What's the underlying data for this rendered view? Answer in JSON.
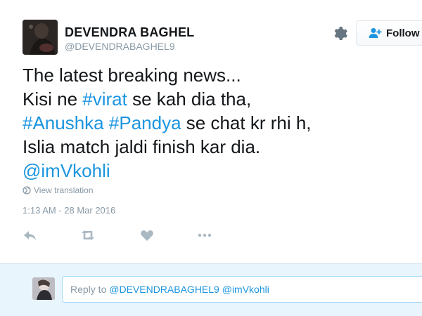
{
  "header": {
    "display_name": "DEVENDRA BAGHEL",
    "screen_name": "@DEVENDRABAGHEL9",
    "gear_icon": "gear-icon",
    "follow_label": "Follow",
    "follow_icon": "add-person-icon"
  },
  "tweet": {
    "line1": "The latest breaking news...",
    "line2_pre": "Kisi ne ",
    "line2_tag": "#virat",
    "line2_post": " se kah dia tha,",
    "line3_tag1": "#Anushka",
    "line3_space": " ",
    "line3_tag2": "#Pandya",
    "line3_post": " se chat kr rhi h,",
    "line4": "Islia match jaldi finish kar dia.",
    "line5_mention": "@imVkohli",
    "view_translation": "View translation",
    "timestamp": "1:13 AM - 28 Mar 2016"
  },
  "actions": [
    "reply-icon",
    "retweet-icon",
    "like-icon",
    "more-icon"
  ],
  "reply": {
    "prefix": "Reply to ",
    "mentions": "@DEVENDRABAGHEL9 @imVkohli"
  },
  "colors": {
    "link": "#1b95e0",
    "muted": "#8899a6",
    "reply_bg": "#e8f5fd"
  }
}
